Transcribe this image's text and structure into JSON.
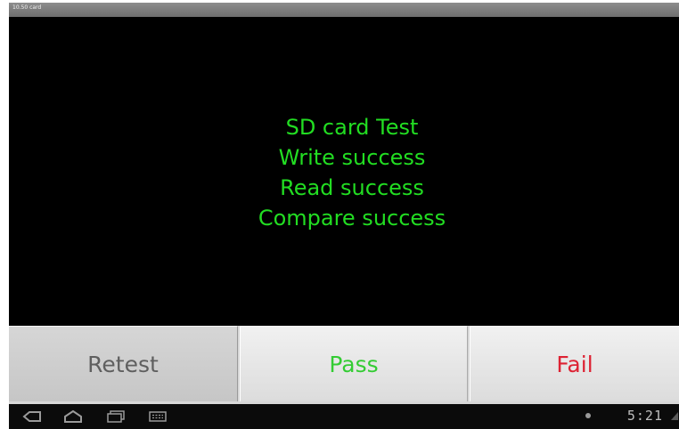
{
  "window": {
    "title": "10.50 card"
  },
  "messages": [
    "SD card Test",
    "Write success",
    "Read success",
    "Compare success"
  ],
  "buttons": {
    "retest": "Retest",
    "pass": "Pass",
    "fail": "Fail"
  },
  "colors": {
    "message_text": "#22dd22",
    "pass_text": "#33cc33",
    "fail_text": "#dd2233",
    "retest_text": "#5f5f5f"
  },
  "navbar": {
    "icons": [
      "back-icon",
      "home-icon",
      "recent-apps-icon",
      "keyboard-icon"
    ],
    "clock": "5:21"
  }
}
